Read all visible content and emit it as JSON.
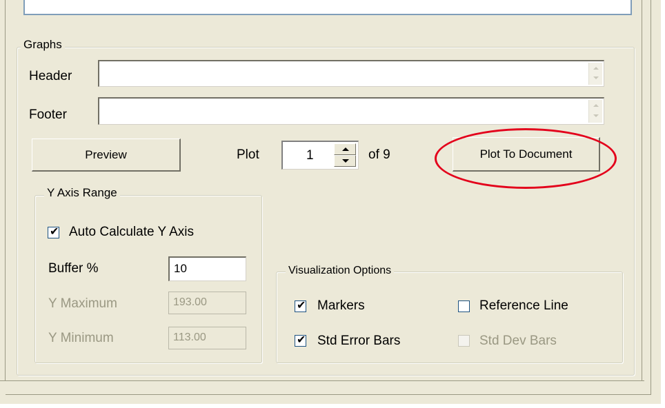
{
  "graphs": {
    "legend": "Graphs",
    "header_label": "Header",
    "header_value": "",
    "footer_label": "Footer",
    "footer_value": "",
    "preview_button": "Preview",
    "plot_label": "Plot",
    "plot_value": "1",
    "plot_of": "of 9",
    "plot_to_document_button": "Plot To Document"
  },
  "y_axis_range": {
    "legend": "Y Axis Range",
    "auto_calculate_label": "Auto Calculate Y Axis",
    "auto_calculate_checked": true,
    "buffer_label": "Buffer %",
    "buffer_value": "10",
    "y_maximum_label": "Y Maximum",
    "y_maximum_value": "193.00",
    "y_minimum_label": "Y Minimum",
    "y_minimum_value": "113.00"
  },
  "visualization_options": {
    "legend": "Visualization Options",
    "markers_label": "Markers",
    "markers_checked": true,
    "reference_line_label": "Reference Line",
    "reference_line_checked": false,
    "std_error_bars_label": "Std Error Bars",
    "std_error_bars_checked": true,
    "std_dev_bars_label": "Std Dev Bars",
    "std_dev_bars_checked": false
  },
  "colors": {
    "dialog_bg": "#ece9d8",
    "textbox_border": "#7f9db9",
    "disabled_text": "#9a9883",
    "highlight_circle": "#e3001b"
  },
  "icons": {
    "spin_up": "spin-up-arrow-icon",
    "spin_down": "spin-down-arrow-icon",
    "check": "checkmark-icon"
  }
}
